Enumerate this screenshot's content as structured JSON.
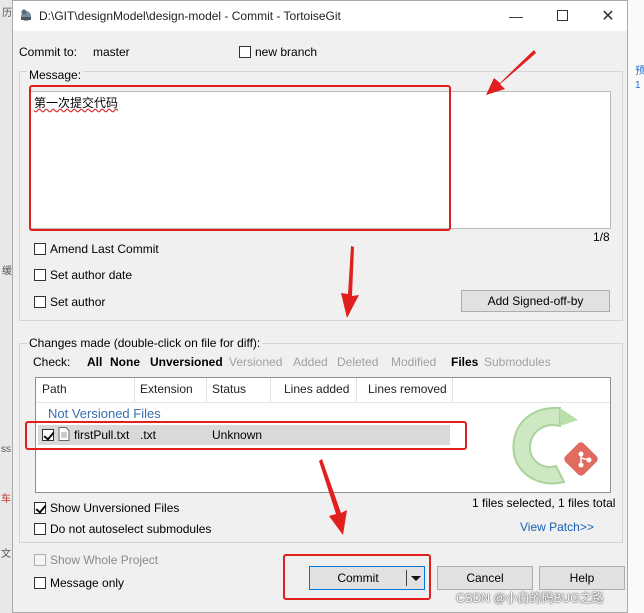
{
  "window": {
    "title": "D:\\GIT\\designModel\\design-model - Commit - TortoiseGit",
    "minimize_icon": "minimize-icon",
    "maximize_icon": "maximize-icon",
    "close_icon": "close-icon"
  },
  "header": {
    "commit_to_label": "Commit to:",
    "branch": "master",
    "new_branch_label": "new branch"
  },
  "message": {
    "label": "Message:",
    "value": "第一次提交代码",
    "counter": "1/8"
  },
  "options": {
    "amend_label": "Amend Last Commit",
    "author_date_label": "Set author date",
    "author_label": "Set author",
    "signoff_button": "Add Signed-off-by"
  },
  "changes": {
    "label": "Changes made (double-click on file for diff):",
    "check_label": "Check:",
    "filters": [
      "All",
      "None",
      "Unversioned",
      "Versioned",
      "Added",
      "Deleted",
      "Modified",
      "Files",
      "Submodules"
    ],
    "columns": [
      "Path",
      "Extension",
      "Status",
      "Lines added",
      "Lines removed"
    ],
    "group_header": "Not Versioned Files",
    "rows": [
      {
        "path": "firstPull.txt",
        "extension": ".txt",
        "status": "Unknown",
        "lines_added": "",
        "lines_removed": ""
      }
    ],
    "show_unversioned_label": "Show Unversioned Files",
    "no_autoselect_label": "Do not autoselect submodules",
    "selection_summary": "1 files selected, 1 files total",
    "view_patch": "View Patch>>"
  },
  "footer": {
    "show_whole_label": "Show Whole Project",
    "message_only_label": "Message only",
    "commit_button": "Commit",
    "cancel_button": "Cancel",
    "help_button": "Help"
  },
  "watermark": "CSDN @小白的码BUG之路",
  "background_fragments": {
    "left": [
      "历",
      "缓",
      "ss",
      "车",
      "文"
    ],
    "right": [
      "预",
      "1"
    ]
  },
  "colors": {
    "annotation_red": "#e21f1f",
    "link_blue": "#1a5fb4",
    "group_header_blue": "#3a6fb0"
  }
}
